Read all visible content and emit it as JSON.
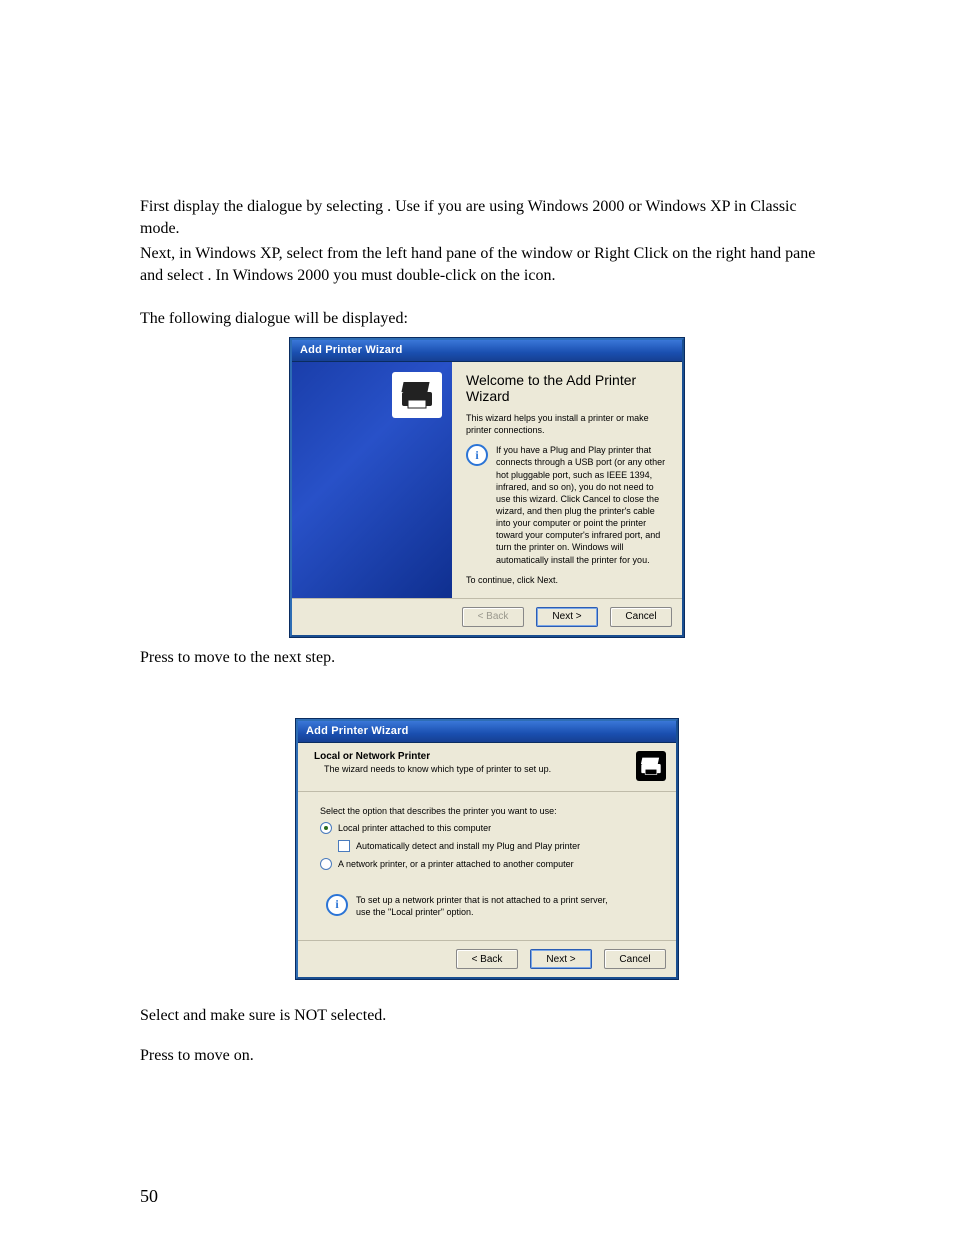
{
  "body": {
    "p1_a": "First display the ",
    "p1_b": " dialogue by selecting ",
    "p1_c": ".  Use ",
    "p1_d": " if you are using Windows 2000 or Windows XP in Classic mode.",
    "p2_a": "Next, in Windows XP, select ",
    "p2_b": " from the left hand pane of the window or Right Click on the right hand pane and select ",
    "p2_c": ". In Windows 2000 you must double-click on the ",
    "p2_d": " icon.",
    "p3": "The following dialogue will be displayed:",
    "p4_a": "Press ",
    "p4_b": " to move to the next step.",
    "p5_a": "Select ",
    "p5_b": " and make sure ",
    "p5_c": " is NOT selected.",
    "p6_a": "Press ",
    "p6_b": " to move on."
  },
  "dlg1": {
    "title": "Add Printer Wizard",
    "heading": "Welcome to the Add Printer Wizard",
    "intro": "This wizard helps you install a printer or make printer connections.",
    "info": "If you have a Plug and Play printer that connects through a USB port (or any other hot pluggable port, such as IEEE 1394, infrared, and so on), you do not need to use this wizard. Click Cancel to close the wizard, and then plug the printer's cable into your computer or point the printer toward your computer's infrared port, and turn the printer on. Windows will automatically install the printer for you.",
    "cont": "To continue, click Next.",
    "btn_back": "< Back",
    "btn_next": "Next >",
    "btn_cancel": "Cancel"
  },
  "dlg2": {
    "title": "Add Printer Wizard",
    "h1": "Local or Network Printer",
    "h2": "The wizard needs to know which type of printer to set up.",
    "prompt": "Select the option that describes the printer you want to use:",
    "opt1": "Local printer attached to this computer",
    "opt1_chk": "Automatically detect and install my Plug and Play printer",
    "opt2": "A network printer, or a printer attached to another computer",
    "info": "To set up a network printer that is not attached to a print server, use the \"Local printer\" option.",
    "btn_back": "< Back",
    "btn_next": "Next >",
    "btn_cancel": "Cancel"
  },
  "page_number": "50"
}
